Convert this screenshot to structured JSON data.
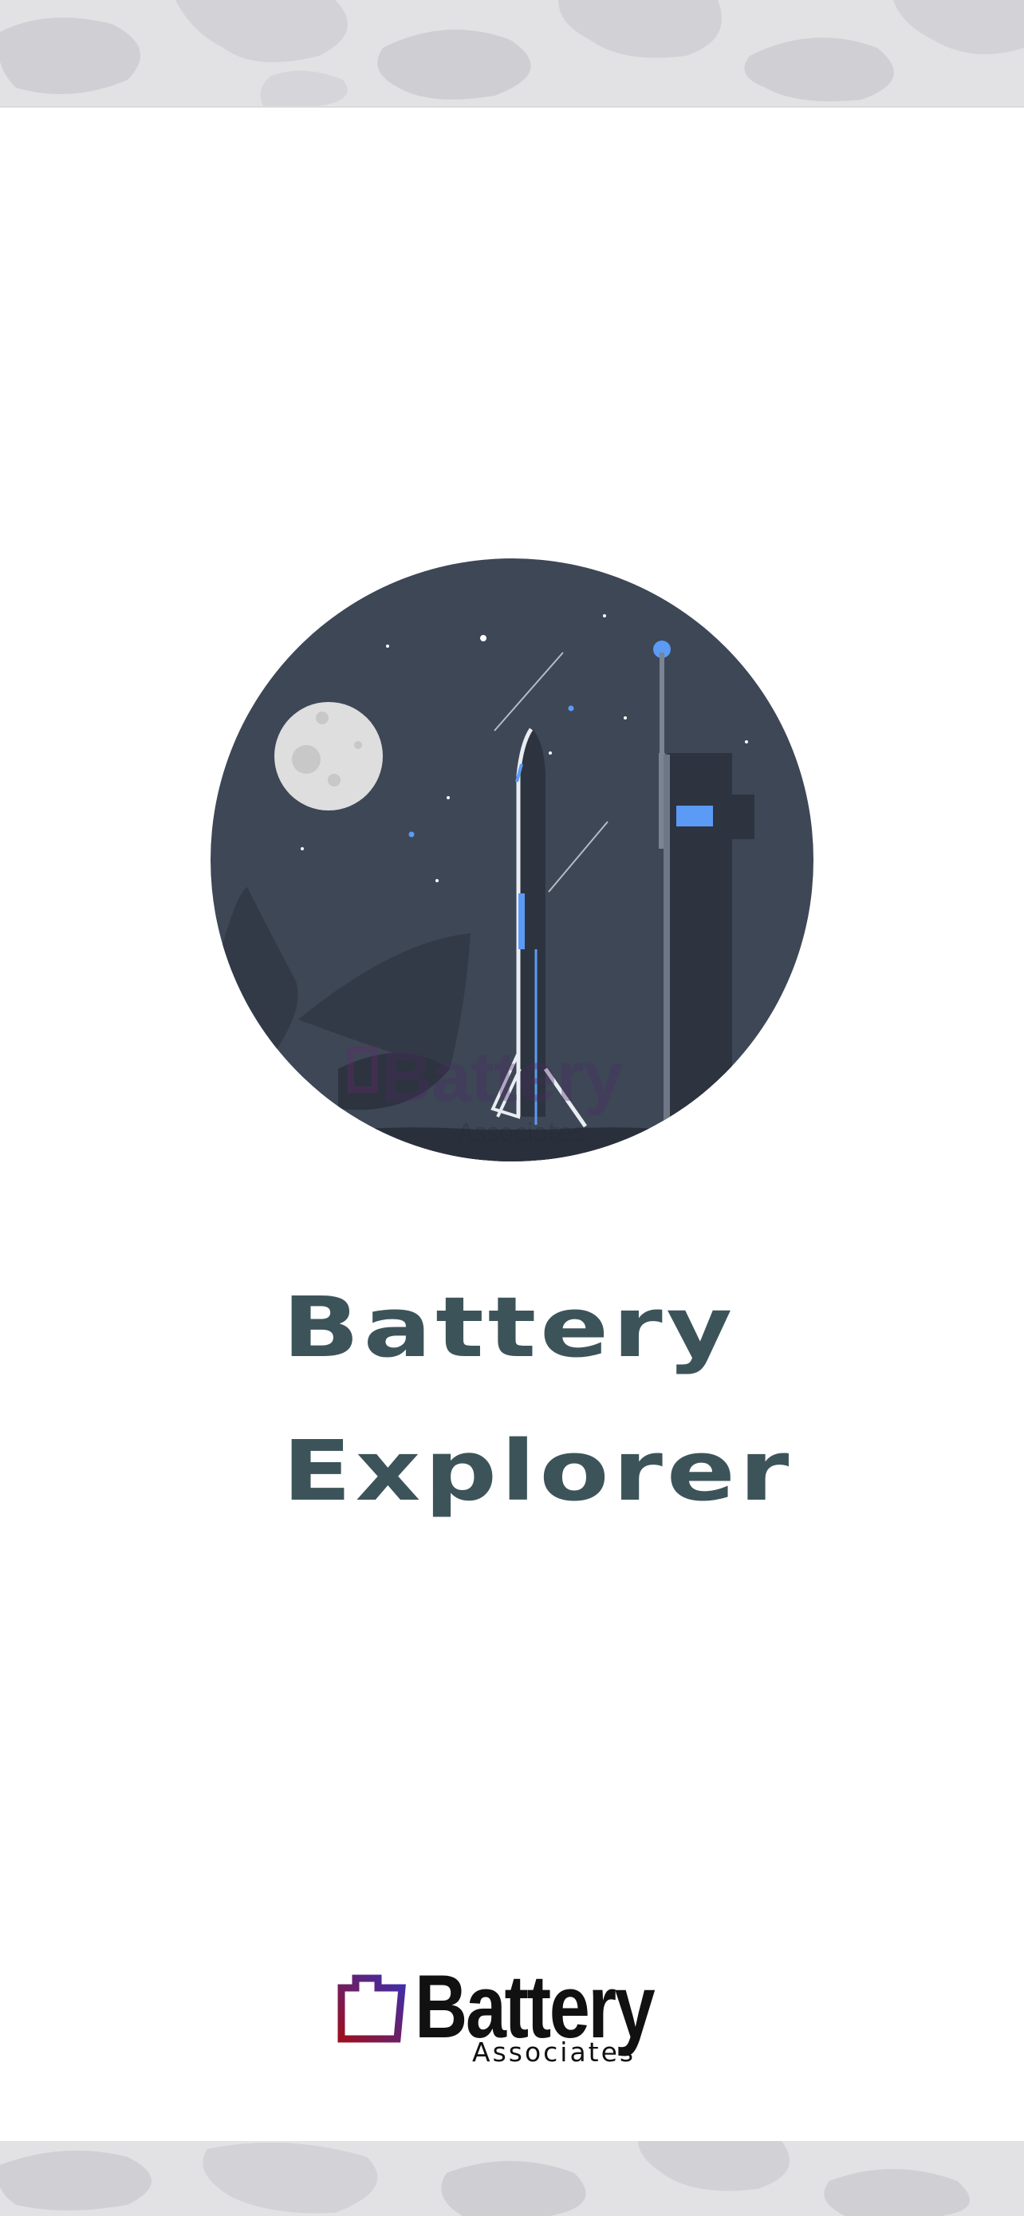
{
  "app": {
    "title_line_1": "Battery",
    "title_line_2": "Explorer"
  },
  "brand": {
    "name": "Battery",
    "tagline": "Associates",
    "logo_icon": "battery-associates-logo-mark"
  },
  "hero": {
    "illustration": "rocket-launchpad-night-scene-icon",
    "watermark_name": "Battery",
    "watermark_tagline": "Associates"
  },
  "colors": {
    "title": "#3c5459",
    "scene_background": "#3d4756",
    "moon": "#dedede",
    "accent_blue": "#5b9bf5",
    "camo_light": "#e4e4e6",
    "camo_dark": "#cfcfd3",
    "logo_red": "#9b1020",
    "logo_blue": "#3b2fb0"
  }
}
